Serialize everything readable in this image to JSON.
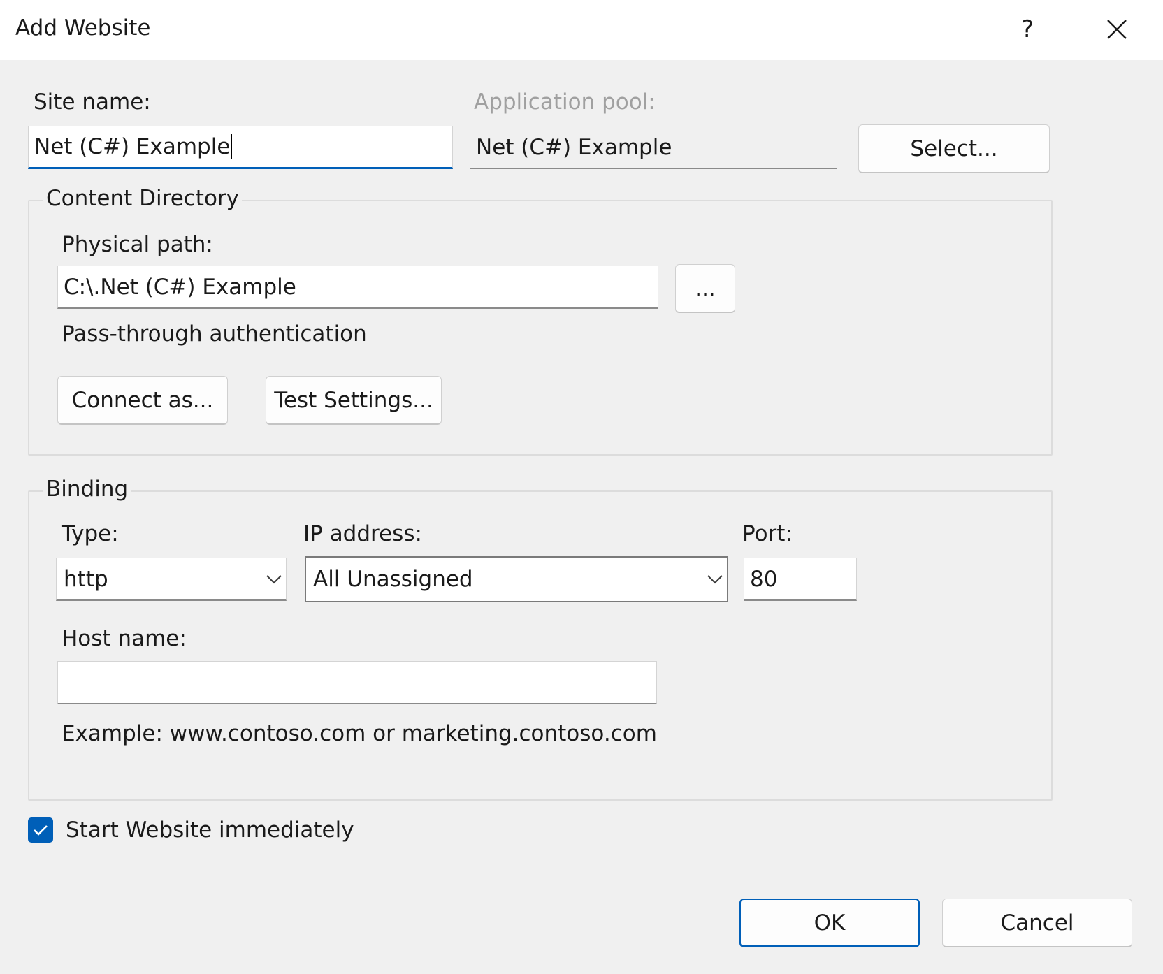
{
  "window": {
    "title": "Add Website",
    "help_label": "?",
    "close_icon": "close-icon"
  },
  "site_name": {
    "label": "Site name:",
    "value": "Net (C#) Example"
  },
  "app_pool": {
    "label": "Application pool:",
    "value": "Net (C#) Example",
    "select_label": "Select..."
  },
  "content_directory": {
    "legend": "Content Directory",
    "physical_path_label": "Physical path:",
    "physical_path_value": "C:\\.Net (C#) Example",
    "browse_label": "...",
    "pass_through_label": "Pass-through authentication",
    "connect_as_label": "Connect as...",
    "test_settings_label": "Test Settings..."
  },
  "binding": {
    "legend": "Binding",
    "type_label": "Type:",
    "type_value": "http",
    "ip_label": "IP address:",
    "ip_value": "All Unassigned",
    "port_label": "Port:",
    "port_value": "80",
    "host_label": "Host name:",
    "host_value": "",
    "example_text": "Example: www.contoso.com or marketing.contoso.com"
  },
  "start_immediately": {
    "label": "Start Website immediately",
    "checked": true
  },
  "footer": {
    "ok_label": "OK",
    "cancel_label": "Cancel"
  },
  "colors": {
    "accent": "#005fb8",
    "background": "#f0f0f0",
    "disabled_text": "#a0a0a0"
  }
}
